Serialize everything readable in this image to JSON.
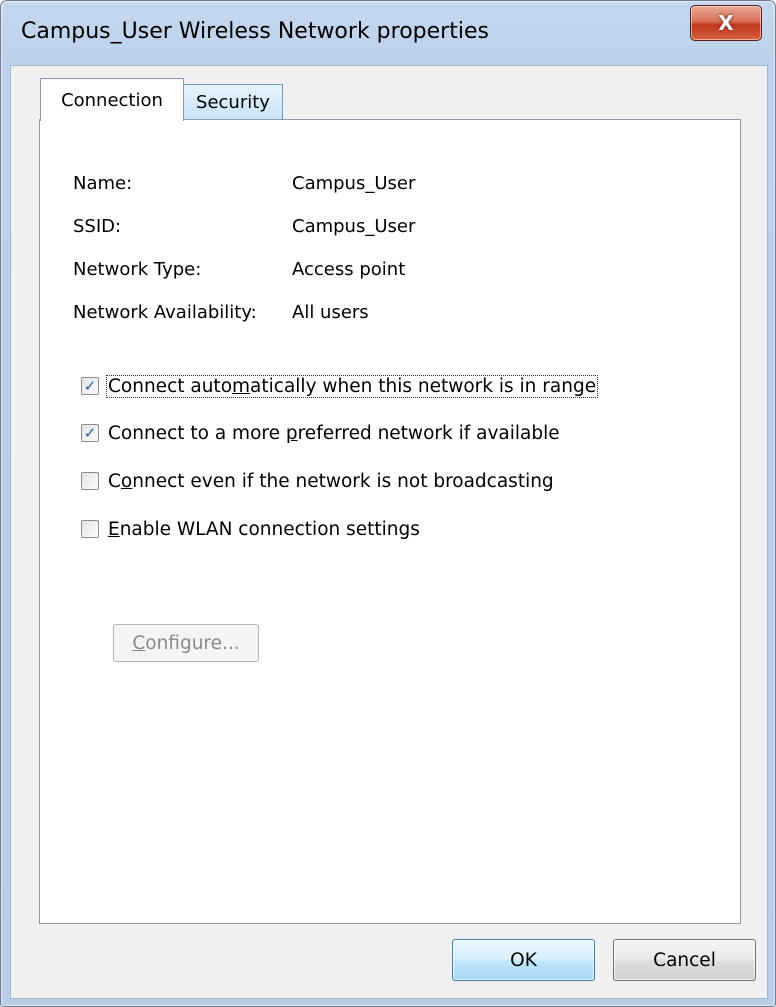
{
  "window": {
    "title": "Campus_User Wireless Network properties",
    "close_icon": "close-icon",
    "close_glyph": "X"
  },
  "tabs": [
    {
      "label": "Connection",
      "selected": true
    },
    {
      "label": "Security",
      "selected": false
    }
  ],
  "info": {
    "name_label": "Name:",
    "name_value": "Campus_User",
    "ssid_label": "SSID:",
    "ssid_value": "Campus_User",
    "type_label": "Network Type:",
    "type_value": "Access point",
    "availability_label": "Network Availability:",
    "availability_value": "All users"
  },
  "options": [
    {
      "pre": "Connect auto",
      "mnemonic": "m",
      "post": "atically when this network is in range",
      "checked": true,
      "focused": true
    },
    {
      "pre": "Connect to a more ",
      "mnemonic": "p",
      "post": "referred network if available",
      "checked": true,
      "focused": false
    },
    {
      "pre": "C",
      "mnemonic": "o",
      "post": "nnect even if the network is not broadcasting",
      "checked": false,
      "focused": false
    },
    {
      "pre": "",
      "mnemonic": "E",
      "post": "nable WLAN connection settings",
      "checked": false,
      "focused": false
    }
  ],
  "configure_button": {
    "mnemonic": "C",
    "rest": "onfigure...",
    "enabled": false
  },
  "footer": {
    "ok_label": "OK",
    "cancel_label": "Cancel"
  },
  "colors": {
    "frame": "#bcd2ea",
    "close_button": "#c1381f",
    "checkmark": "#2c5fa8"
  }
}
